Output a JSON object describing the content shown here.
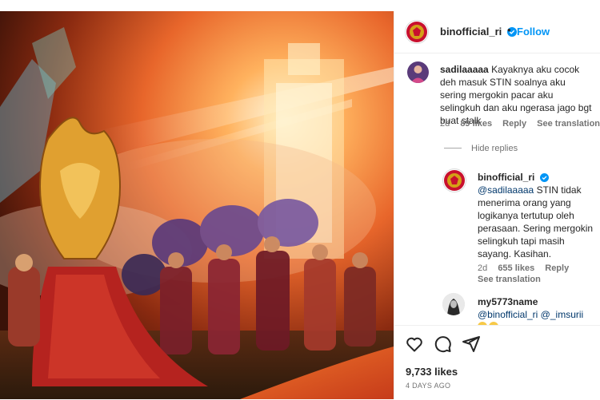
{
  "post": {
    "username": "binofficial_ri",
    "follow_label": "Follow",
    "header_dot": "•",
    "likes": "9,733 likes",
    "date": "4 DAYS AGO"
  },
  "comments": [
    {
      "username": "sadilaaaaa",
      "text": "Kayaknya aku cocok deh masuk STIN soalnya aku sering mergokin pacar aku selingkuh dan aku ngerasa jago bgt buat stalk",
      "time": "2d",
      "likes": "89 likes",
      "reply": "Reply",
      "translate": "See translation"
    }
  ],
  "hide_replies": "Hide replies",
  "replies": [
    {
      "username": "binofficial_ri",
      "mention": "@sadilaaaaa",
      "text": "STIN tidak menerima orang yang logikanya tertutup oleh perasaan. Sering mergokin selingkuh tapi masih sayang. Kasihan.",
      "time": "2d",
      "likes": "655 likes",
      "reply": "Reply",
      "translate": "See translation"
    },
    {
      "username": "my5773name",
      "mention1": "@binofficial_ri",
      "mention2": "@_imsurii"
    }
  ],
  "icons": [
    "heart-icon",
    "comment-icon",
    "share-icon",
    "verified-badge-icon"
  ],
  "colors": {
    "accent": "#0095f6",
    "link": "#00376b",
    "text": "#262626",
    "muted": "#737373",
    "emblem_red": "#c8102e",
    "emblem_gold": "#d4a017"
  }
}
